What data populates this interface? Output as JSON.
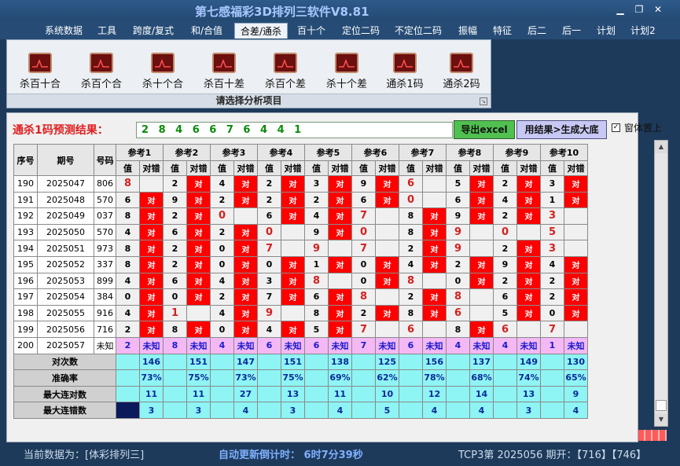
{
  "app": {
    "title": "第七感福彩3D排列三软件V8.81"
  },
  "window": {
    "minimize_icon": "minimize-icon",
    "maximize_icon": "maximize-icon",
    "close_icon": "close-icon"
  },
  "menu": [
    "系统数据",
    "工具",
    "跨度/复式",
    "和/合值",
    "合差/通杀",
    "百十个",
    "定位二码",
    "不定位二码",
    "振幅",
    "特征",
    "后二",
    "后一",
    "计划",
    "计划2"
  ],
  "menu_active_index": 4,
  "ribbon": {
    "items": [
      "杀百十合",
      "杀百个合",
      "杀十个合",
      "杀百十差",
      "杀百个差",
      "杀十个差",
      "通杀1码",
      "通杀2码"
    ],
    "icon": "chart-icon",
    "footer": "请选择分析项目"
  },
  "prediction": {
    "label": "通杀1码预测结果：",
    "value": "2 8 4 6 6 7 6 4 4 1"
  },
  "buttons": {
    "export": "导出excel",
    "generate": "用结果>生成大底"
  },
  "pin": {
    "label": "窗体置上",
    "checked_mark": "✓"
  },
  "table": {
    "headers": {
      "seq": "序号",
      "period": "期号",
      "code": "号码",
      "refs": [
        "参考1",
        "参考2",
        "参考3",
        "参考4",
        "参考5",
        "参考6",
        "参考7",
        "参考8",
        "参考9",
        "参考10"
      ],
      "val": "值",
      "check": "对错"
    },
    "correct": "对",
    "unknown": "未知",
    "rows": [
      {
        "seq": "190",
        "period": "2025047",
        "code": "806",
        "vals": [
          "8",
          "2",
          "4",
          "2",
          "3",
          "9",
          "6",
          "5",
          "2",
          "3"
        ],
        "marks": [
          0,
          1,
          1,
          1,
          1,
          1,
          0,
          1,
          1,
          1
        ]
      },
      {
        "seq": "191",
        "period": "2025048",
        "code": "570",
        "vals": [
          "6",
          "9",
          "2",
          "2",
          "2",
          "6",
          "0",
          "6",
          "4",
          "1"
        ],
        "marks": [
          1,
          1,
          1,
          1,
          1,
          1,
          0,
          1,
          1,
          1
        ]
      },
      {
        "seq": "192",
        "period": "2025049",
        "code": "037",
        "vals": [
          "8",
          "2",
          "0",
          "6",
          "4",
          "7",
          "8",
          "9",
          "2",
          "3"
        ],
        "marks": [
          1,
          1,
          0,
          1,
          1,
          0,
          1,
          1,
          1,
          0
        ]
      },
      {
        "seq": "193",
        "period": "2025050",
        "code": "570",
        "vals": [
          "4",
          "6",
          "2",
          "0",
          "9",
          "0",
          "8",
          "9",
          "0",
          "5"
        ],
        "marks": [
          1,
          1,
          1,
          0,
          1,
          0,
          1,
          0,
          0,
          0
        ]
      },
      {
        "seq": "194",
        "period": "2025051",
        "code": "973",
        "vals": [
          "8",
          "2",
          "0",
          "7",
          "9",
          "7",
          "2",
          "9",
          "2",
          "3"
        ],
        "marks": [
          1,
          1,
          1,
          0,
          0,
          0,
          1,
          0,
          1,
          0
        ]
      },
      {
        "seq": "195",
        "period": "2025052",
        "code": "337",
        "vals": [
          "8",
          "2",
          "0",
          "0",
          "1",
          "0",
          "4",
          "2",
          "9",
          "4"
        ],
        "marks": [
          1,
          1,
          1,
          1,
          1,
          1,
          1,
          1,
          1,
          1
        ]
      },
      {
        "seq": "196",
        "period": "2025053",
        "code": "899",
        "vals": [
          "4",
          "6",
          "4",
          "3",
          "8",
          "0",
          "8",
          "0",
          "2",
          "2"
        ],
        "marks": [
          1,
          1,
          1,
          1,
          0,
          1,
          0,
          1,
          1,
          1
        ]
      },
      {
        "seq": "197",
        "period": "2025054",
        "code": "384",
        "vals": [
          "0",
          "0",
          "2",
          "7",
          "6",
          "8",
          "2",
          "8",
          "6",
          "2"
        ],
        "marks": [
          1,
          1,
          1,
          1,
          1,
          0,
          1,
          0,
          1,
          1
        ]
      },
      {
        "seq": "198",
        "period": "2025055",
        "code": "916",
        "vals": [
          "4",
          "1",
          "4",
          "9",
          "8",
          "2",
          "8",
          "6",
          "5",
          "0"
        ],
        "marks": [
          1,
          0,
          1,
          0,
          1,
          1,
          1,
          0,
          1,
          1
        ]
      },
      {
        "seq": "199",
        "period": "2025056",
        "code": "716",
        "vals": [
          "2",
          "8",
          "0",
          "4",
          "5",
          "7",
          "6",
          "8",
          "6",
          "7"
        ],
        "marks": [
          1,
          1,
          1,
          1,
          1,
          0,
          0,
          1,
          0,
          0
        ]
      },
      {
        "seq": "200",
        "period": "2025057",
        "code": "未知",
        "vals": [
          "2",
          "8",
          "4",
          "6",
          "6",
          "7",
          "6",
          "4",
          "4",
          "1"
        ],
        "marks": [
          2,
          2,
          2,
          2,
          2,
          2,
          2,
          2,
          2,
          2
        ]
      }
    ],
    "stats": [
      {
        "label": "对次数",
        "values": [
          "146",
          "151",
          "147",
          "151",
          "138",
          "125",
          "156",
          "137",
          "149",
          "130"
        ]
      },
      {
        "label": "准确率",
        "values": [
          "73%",
          "75%",
          "73%",
          "75%",
          "69%",
          "62%",
          "78%",
          "68%",
          "74%",
          "65%"
        ]
      },
      {
        "label": "最大连对数",
        "values": [
          "11",
          "11",
          "27",
          "13",
          "11",
          "10",
          "12",
          "14",
          "13",
          "9"
        ]
      },
      {
        "label": "最大连错数",
        "values": [
          "3",
          "3",
          "4",
          "3",
          "4",
          "5",
          "4",
          "4",
          "3",
          "4"
        ]
      }
    ]
  },
  "status": {
    "current": "当前数据为：[体彩排列三]",
    "countdown": "自动更新倒计时： 6时7分39秒",
    "latest": "TCP3第 2025056 期开：【716】【746】"
  },
  "colors": {
    "mark": "#ff0000",
    "hit": "#d42020",
    "unknown": "#f4b8f4",
    "stat": "#8ef4f4",
    "title": "#a8c8ff"
  }
}
